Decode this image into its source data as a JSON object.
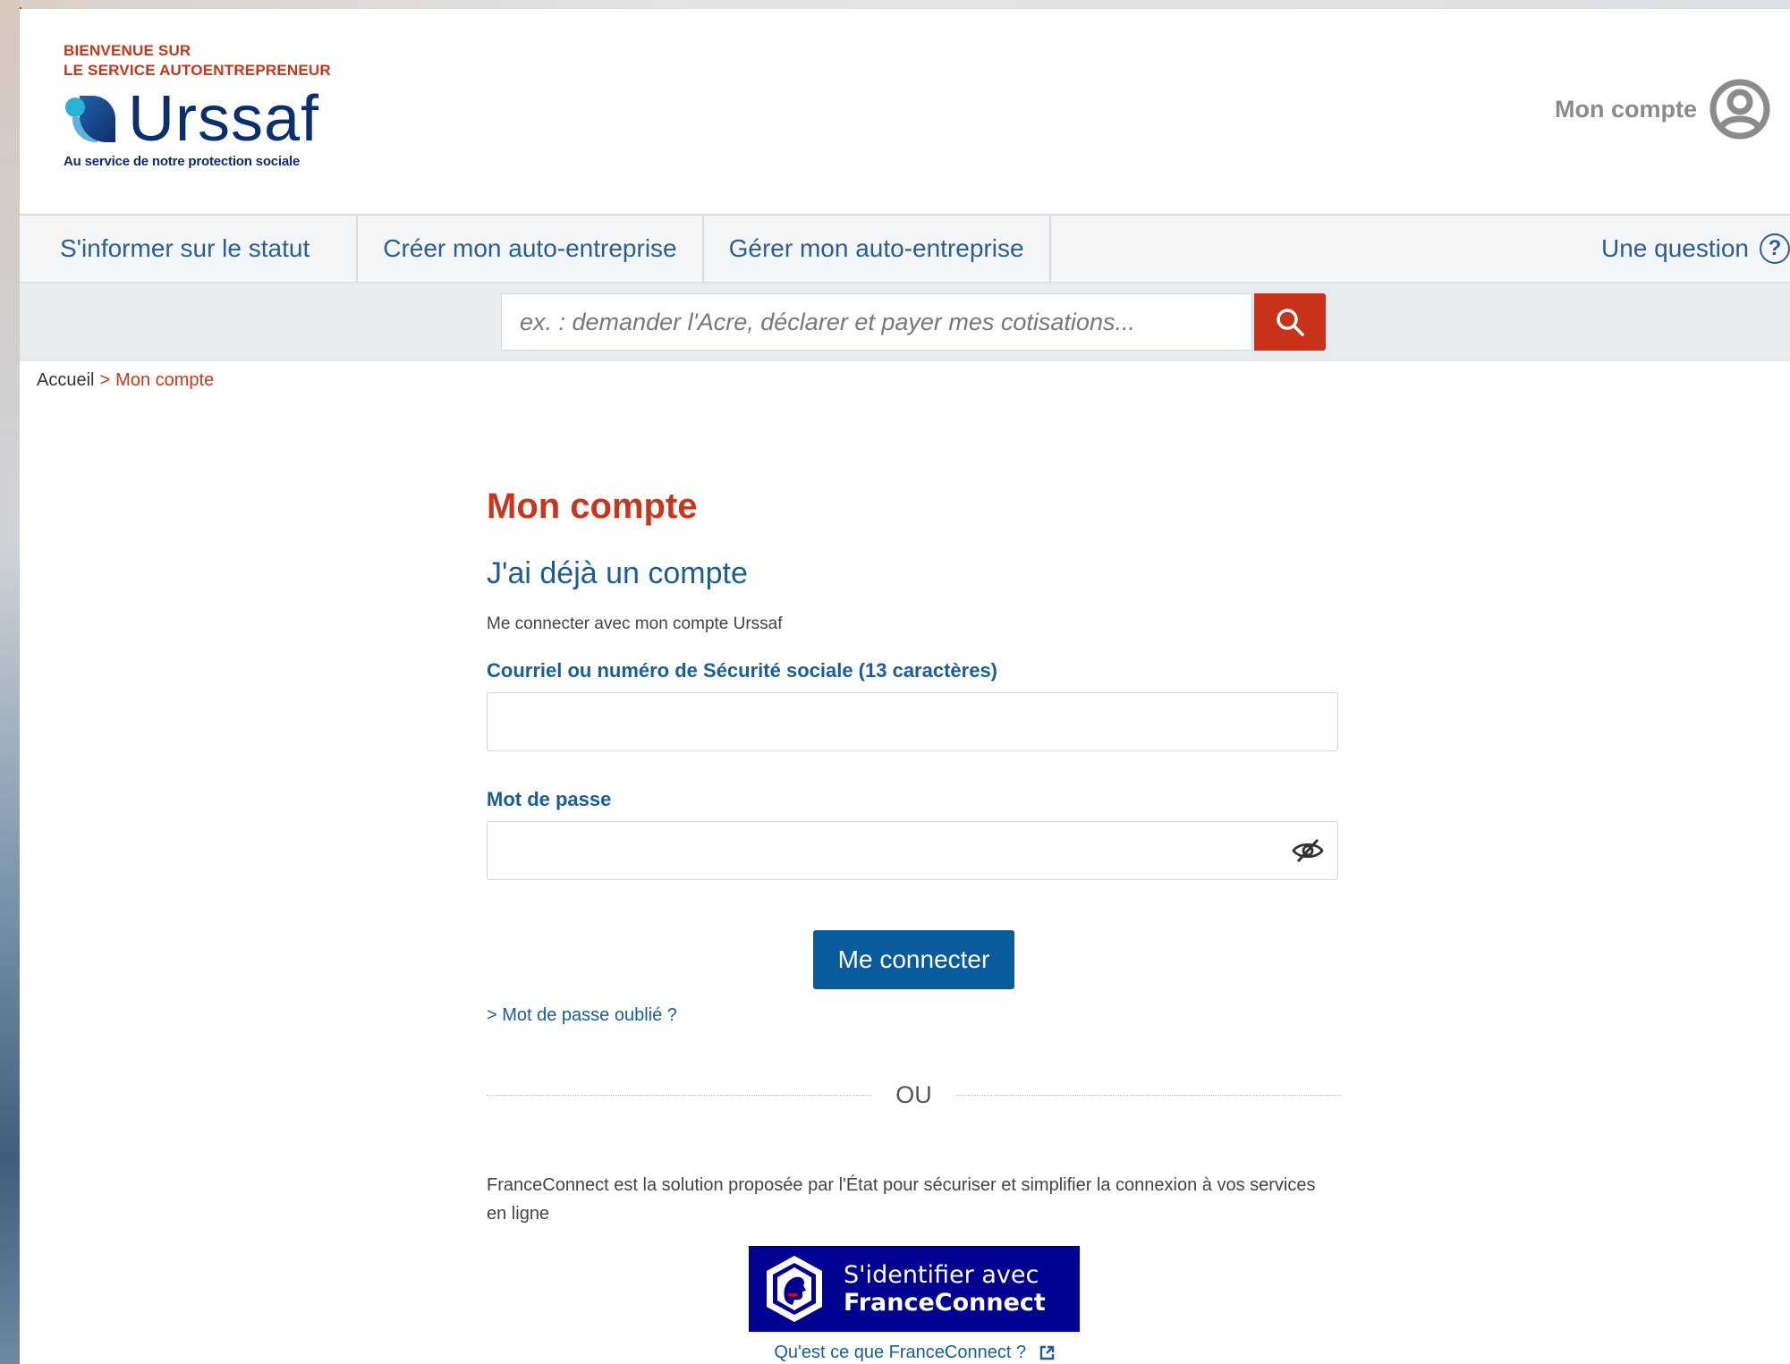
{
  "header": {
    "welcome_line1": "BIENVENUE SUR",
    "welcome_line2": "LE SERVICE AUTOENTREPRENEUR",
    "brand_name": "Urssaf",
    "brand_tagline": "Au service de notre protection sociale",
    "account_label": "Mon compte",
    "account_icon": "user-circle-icon"
  },
  "nav": {
    "items": [
      {
        "label": "S'informer sur le statut"
      },
      {
        "label": "Créer mon auto-entreprise"
      },
      {
        "label": "Gérer mon auto-entreprise"
      }
    ],
    "question_label": "Une question",
    "question_icon": "help-circle-icon"
  },
  "search": {
    "placeholder": "ex. : demander l'Acre, déclarer et payer mes cotisations...",
    "value": "",
    "button_icon": "search-icon"
  },
  "breadcrumb": {
    "home": "Accueil",
    "separator": ">",
    "current": "Mon compte"
  },
  "main": {
    "title": "Mon compte",
    "section_title": "J'ai déjà un compte",
    "section_desc": "Me connecter avec mon compte Urssaf",
    "login_label": "Courriel ou numéro de Sécurité sociale (13 caractères)",
    "login_value": "",
    "password_label": "Mot de passe",
    "password_value": "",
    "password_toggle_icon": "eye-slash-icon",
    "submit_label": "Me connecter",
    "forgot_link": "> Mot de passe oublié ?",
    "divider_label": "OU",
    "fc_desc": "FranceConnect est la solution proposée par l'État pour sécuriser et simplifier la connexion à vos services en ligne",
    "fc_button_line1": "S'identifier avec",
    "fc_button_line2": "FranceConnect",
    "fc_info_link": "Qu'est ce que FranceConnect ?",
    "fc_info_icon": "external-link-icon"
  },
  "colors": {
    "brand_red": "#c8361c",
    "link_blue": "#1a5e98",
    "button_blue": "#0a5b9c",
    "franceconnect_blue": "#000091",
    "search_red": "#c8321a"
  }
}
